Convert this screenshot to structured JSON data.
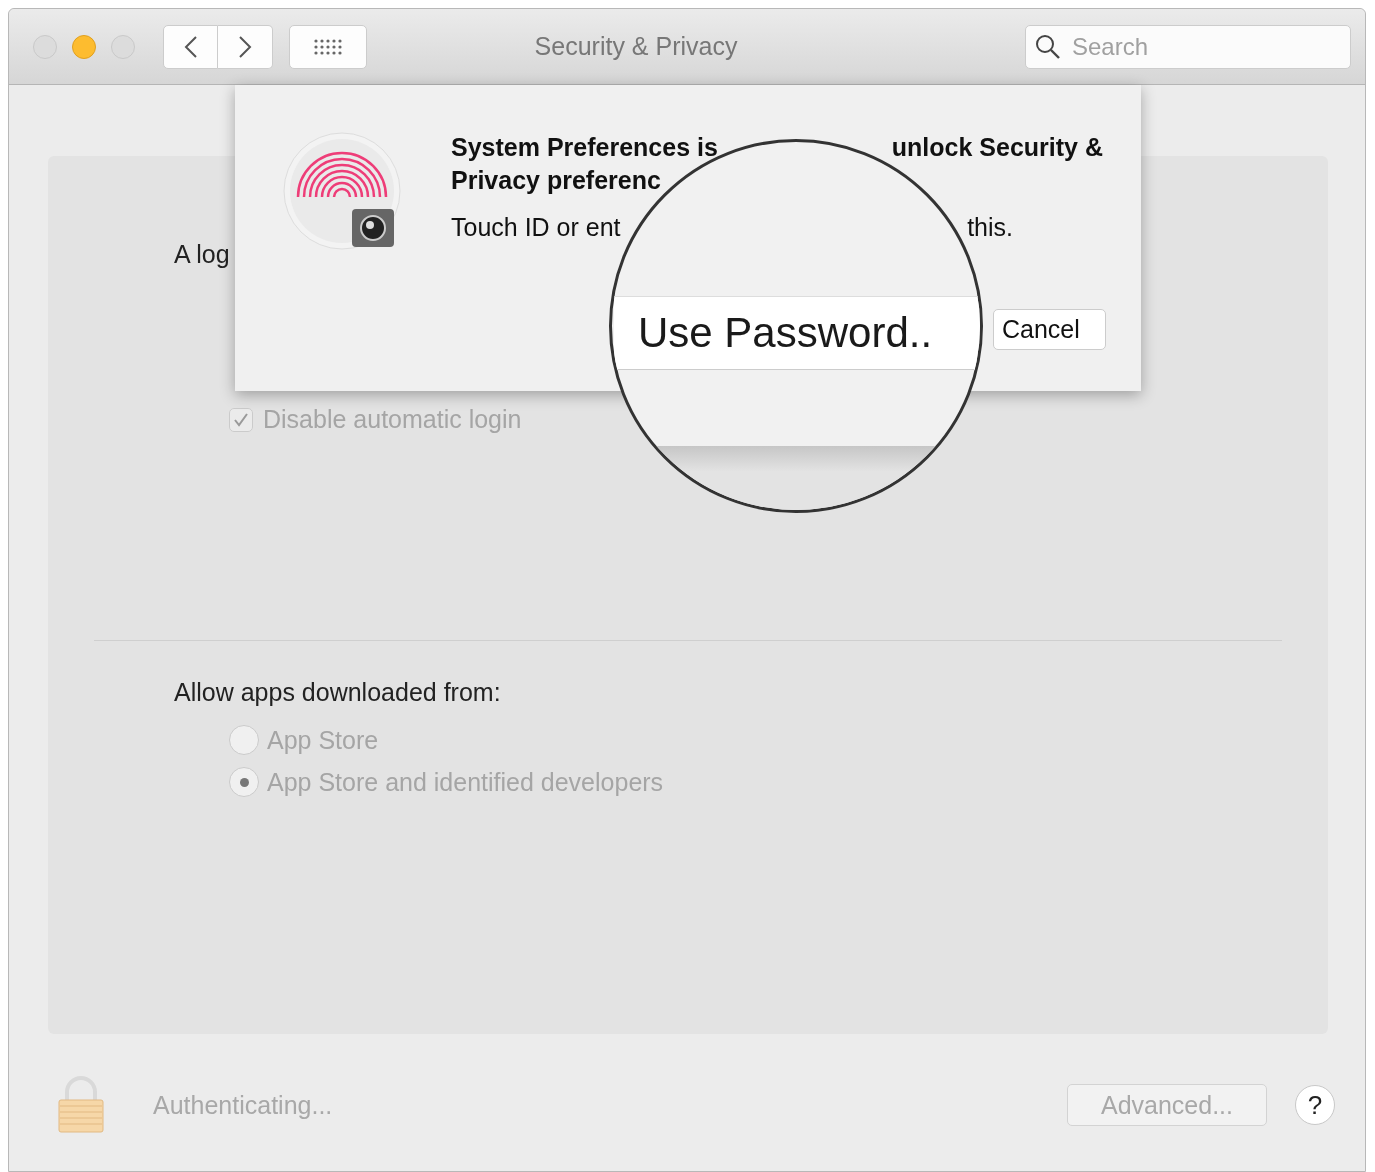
{
  "window": {
    "title": "Security & Privacy",
    "traffic_lights": [
      {
        "active": false
      },
      {
        "active": true
      },
      {
        "active": false
      }
    ]
  },
  "toolbar": {
    "search": {
      "placeholder": "Search"
    }
  },
  "panel": {
    "login_text": "A log",
    "checkbox": {
      "label": "Disable automatic login",
      "checked": true,
      "disabled": true
    },
    "allow_label": "Allow apps downloaded from:",
    "radios": [
      {
        "label": "App Store",
        "selected": false,
        "disabled": true
      },
      {
        "label": "App Store and identified developers",
        "selected": true,
        "disabled": true
      }
    ]
  },
  "dialog": {
    "title_start": "System Preferences is",
    "title_end": "unlock Security &",
    "title_line2": "Privacy preferenc",
    "message_start": "Touch ID or ent",
    "message_end": "this.",
    "cancel": "Cancel"
  },
  "magnifier": {
    "button": "Use Password.."
  },
  "footer": {
    "status": "Authenticating...",
    "advanced": "Advanced...",
    "help": "?"
  }
}
